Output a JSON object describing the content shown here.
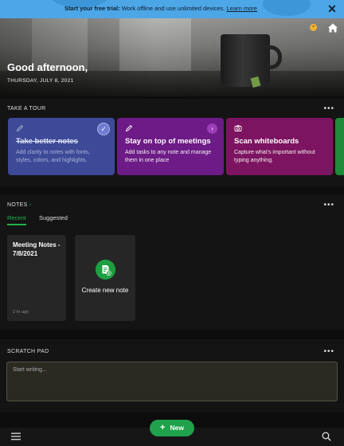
{
  "banner": {
    "lead": "Start your free trial:",
    "text": " Work offline and use unlimited devices. ",
    "link": "Learn more",
    "close": "✕"
  },
  "hero": {
    "greeting": "Good afternoon,",
    "date": "THURSDAY, JULY 8, 2021"
  },
  "tour": {
    "title": "TAKE A TOUR",
    "more": "•••",
    "cards": [
      {
        "title": "Take better notes",
        "desc": "Add clarity to notes with fonts, styles, colors, and highlights.",
        "icon": "pencil-icon",
        "done": true
      },
      {
        "title": "Stay on top of meetings",
        "desc": "Add tasks to any note and manage them in one place",
        "icon": "pencil-icon"
      },
      {
        "title": "Scan whiteboards",
        "desc": "Capture what's important without typing anything.",
        "icon": "camera-icon"
      }
    ]
  },
  "notes": {
    "title": "NOTES",
    "chevron": "›",
    "more": "•••",
    "tabs": {
      "recent": "Recent",
      "suggested": "Suggested"
    },
    "items": [
      {
        "title": "Meeting Notes - 7/8/2021",
        "time": "2 hr ago"
      }
    ],
    "create": {
      "label": "Create new note"
    }
  },
  "scratch": {
    "title": "SCRATCH PAD",
    "more": "•••",
    "placeholder": "Start writing..."
  },
  "bottom": {
    "new_label": "New",
    "plus": "+"
  },
  "colors": {
    "accent_green": "#1fa24b",
    "banner_blue": "#4da6e6",
    "card_blue": "#3d4a97",
    "card_purple": "#6d1b86",
    "card_magenta": "#7d1461"
  }
}
